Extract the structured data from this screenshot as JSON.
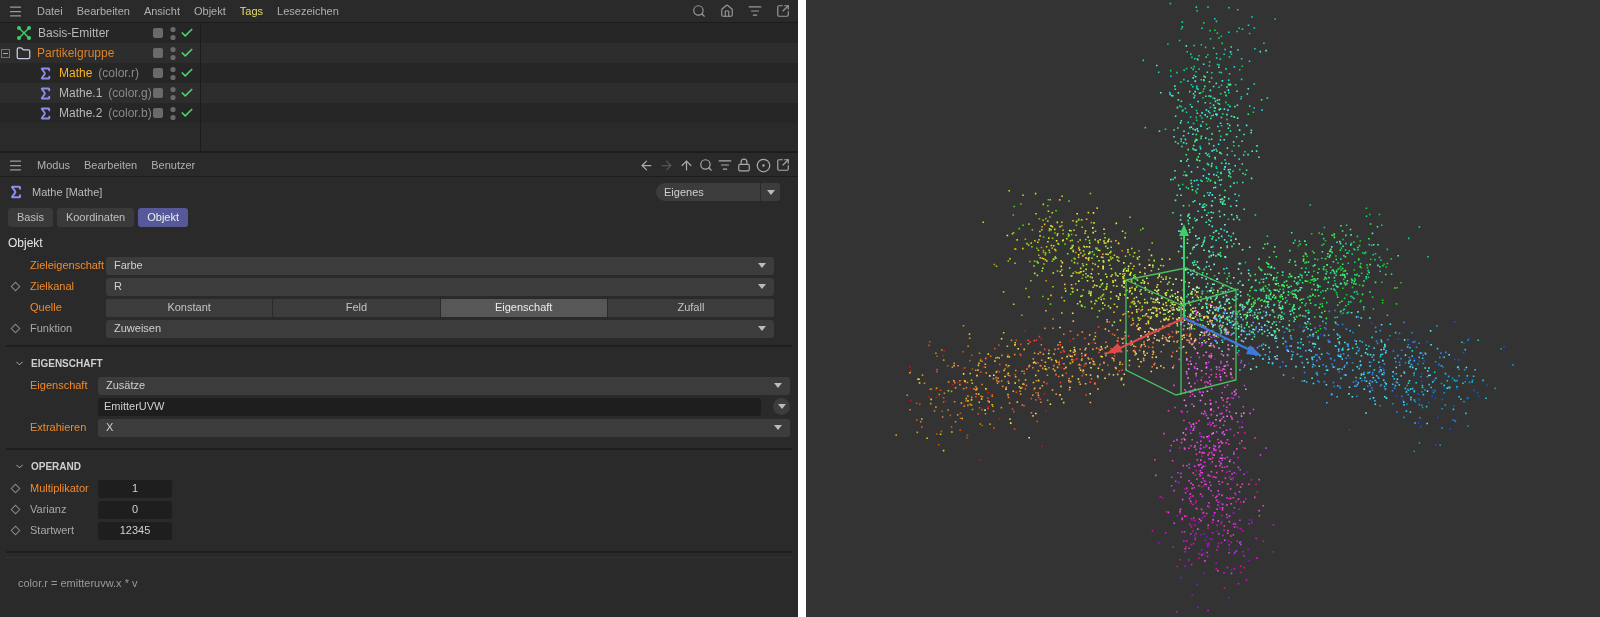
{
  "object_manager": {
    "menu": [
      {
        "label": "Datei",
        "active": false
      },
      {
        "label": "Bearbeiten",
        "active": false
      },
      {
        "label": "Ansicht",
        "active": false
      },
      {
        "label": "Objekt",
        "active": false
      },
      {
        "label": "Tags",
        "active": true
      },
      {
        "label": "Lesezeichen",
        "active": false
      }
    ],
    "objects": [
      {
        "name": "Basis-Emitter",
        "kind": "emitter",
        "selected": false
      },
      {
        "name": "Partikelgruppe",
        "kind": "group",
        "selected": false,
        "expanded": true,
        "children": [
          {
            "name": "Mathe",
            "tag": "(color.r)",
            "kind": "math",
            "selected": true
          },
          {
            "name": "Mathe.1",
            "tag": "(color.g)",
            "kind": "math",
            "selected": false
          },
          {
            "name": "Mathe.2",
            "tag": "(color.b)",
            "kind": "math",
            "selected": false
          }
        ]
      }
    ]
  },
  "attribute_manager": {
    "menu": [
      "Modus",
      "Bearbeiten",
      "Benutzer"
    ],
    "title": "Mathe [Mathe]",
    "mode": "Eigenes",
    "tabs": [
      {
        "label": "Basis",
        "selected": false
      },
      {
        "label": "Koordinaten",
        "selected": false
      },
      {
        "label": "Objekt",
        "selected": true
      }
    ],
    "section_title": "Objekt",
    "params": [
      {
        "label": "Zieleigenschaft",
        "kind": "dropdown",
        "value": "Farbe",
        "modified": true,
        "keyframe": false
      },
      {
        "label": "Zielkanal",
        "kind": "dropdown",
        "value": "R",
        "modified": true,
        "keyframe": true
      },
      {
        "label": "Quelle",
        "kind": "segmented",
        "modified": true,
        "keyframe": false,
        "options": [
          {
            "label": "Konstant",
            "selected": false
          },
          {
            "label": "Feld",
            "selected": false
          },
          {
            "label": "Eigenschaft",
            "selected": true
          },
          {
            "label": "Zufall",
            "selected": false
          }
        ]
      },
      {
        "label": "Funktion",
        "kind": "dropdown",
        "value": "Zuweisen",
        "modified": false,
        "keyframe": true
      }
    ],
    "groups": [
      {
        "title": "EIGENSCHAFT",
        "expanded": true,
        "params": [
          {
            "label": "Eigenschaft",
            "kind": "dropdown",
            "value": "Zusätze",
            "modified": true,
            "keyframe": false
          },
          {
            "kind": "text",
            "value": "EmitterUVW",
            "keyframe": false
          },
          {
            "label": "Extrahieren",
            "kind": "dropdown",
            "value": "X",
            "modified": true,
            "keyframe": false
          }
        ]
      },
      {
        "title": "OPERAND",
        "expanded": true,
        "params": [
          {
            "label": "Multiplikator",
            "kind": "number",
            "value": "1",
            "modified": true,
            "keyframe": true
          },
          {
            "label": "Varianz",
            "kind": "number",
            "value": "0",
            "modified": false,
            "keyframe": true
          },
          {
            "label": "Startwert",
            "kind": "number",
            "value": "12345",
            "modified": false,
            "keyframe": true
          }
        ]
      }
    ],
    "formula": "color.r = emitteruvw.x * v"
  }
}
